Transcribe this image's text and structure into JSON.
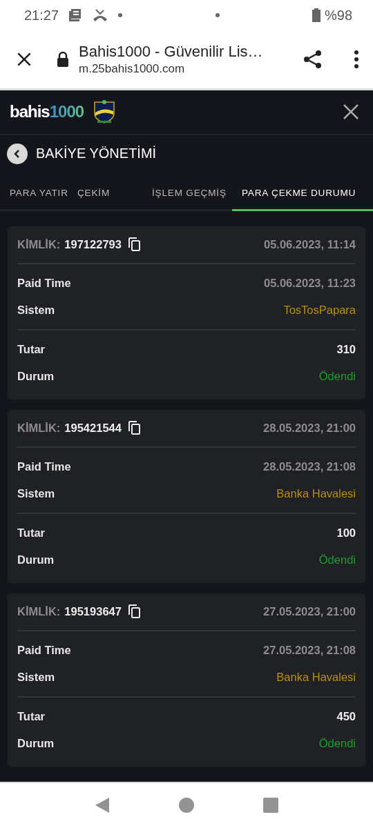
{
  "status_bar": {
    "time": "21:27",
    "battery": "%98"
  },
  "browser": {
    "title": "Bahis1000 - Güvenilir Lis…",
    "url": "m.25bahis1000.com"
  },
  "logo": {
    "word": "bahis",
    "number": "1000"
  },
  "section_title": "BAKİYE YÖNETİMİ",
  "tabs": [
    {
      "label": "PARA YATIR",
      "selected": false
    },
    {
      "label": "ÇEKİM",
      "selected": false
    },
    {
      "label": "İŞLEM GEÇMİŞ",
      "selected": false
    },
    {
      "label": "PARA ÇEKME DURUMU",
      "selected": true
    }
  ],
  "cards": [
    {
      "id_label": "KİMLİK:",
      "id": "197122793",
      "created": "05.06.2023, 11:14",
      "groups": [
        [
          {
            "label": "Paid Time",
            "value": "05.06.2023, 11:23",
            "kind": "date"
          },
          {
            "label": "Sistem",
            "value": "TosTosPapara",
            "kind": "system"
          }
        ],
        [
          {
            "label": "Tutar",
            "value": "310",
            "kind": "amount"
          },
          {
            "label": "Durum",
            "value": "Ödendi",
            "kind": "status"
          }
        ]
      ]
    },
    {
      "id_label": "KİMLİK:",
      "id": "195421544",
      "created": "28.05.2023, 21:00",
      "groups": [
        [
          {
            "label": "Paid Time",
            "value": "28.05.2023, 21:08",
            "kind": "date"
          },
          {
            "label": "Sistem",
            "value": "Banka Havalesi",
            "kind": "system"
          }
        ],
        [
          {
            "label": "Tutar",
            "value": "100",
            "kind": "amount"
          },
          {
            "label": "Durum",
            "value": "Ödendi",
            "kind": "status"
          }
        ]
      ]
    },
    {
      "id_label": "KİMLİK:",
      "id": "195193647",
      "created": "27.05.2023, 21:00",
      "groups": [
        [
          {
            "label": "Paid Time",
            "value": "27.05.2023, 21:08",
            "kind": "date"
          },
          {
            "label": "Sistem",
            "value": "Banka Havalesi",
            "kind": "system"
          }
        ],
        [
          {
            "label": "Tutar",
            "value": "450",
            "kind": "amount"
          },
          {
            "label": "Durum",
            "value": "Ödendi",
            "kind": "status"
          }
        ]
      ]
    }
  ]
}
